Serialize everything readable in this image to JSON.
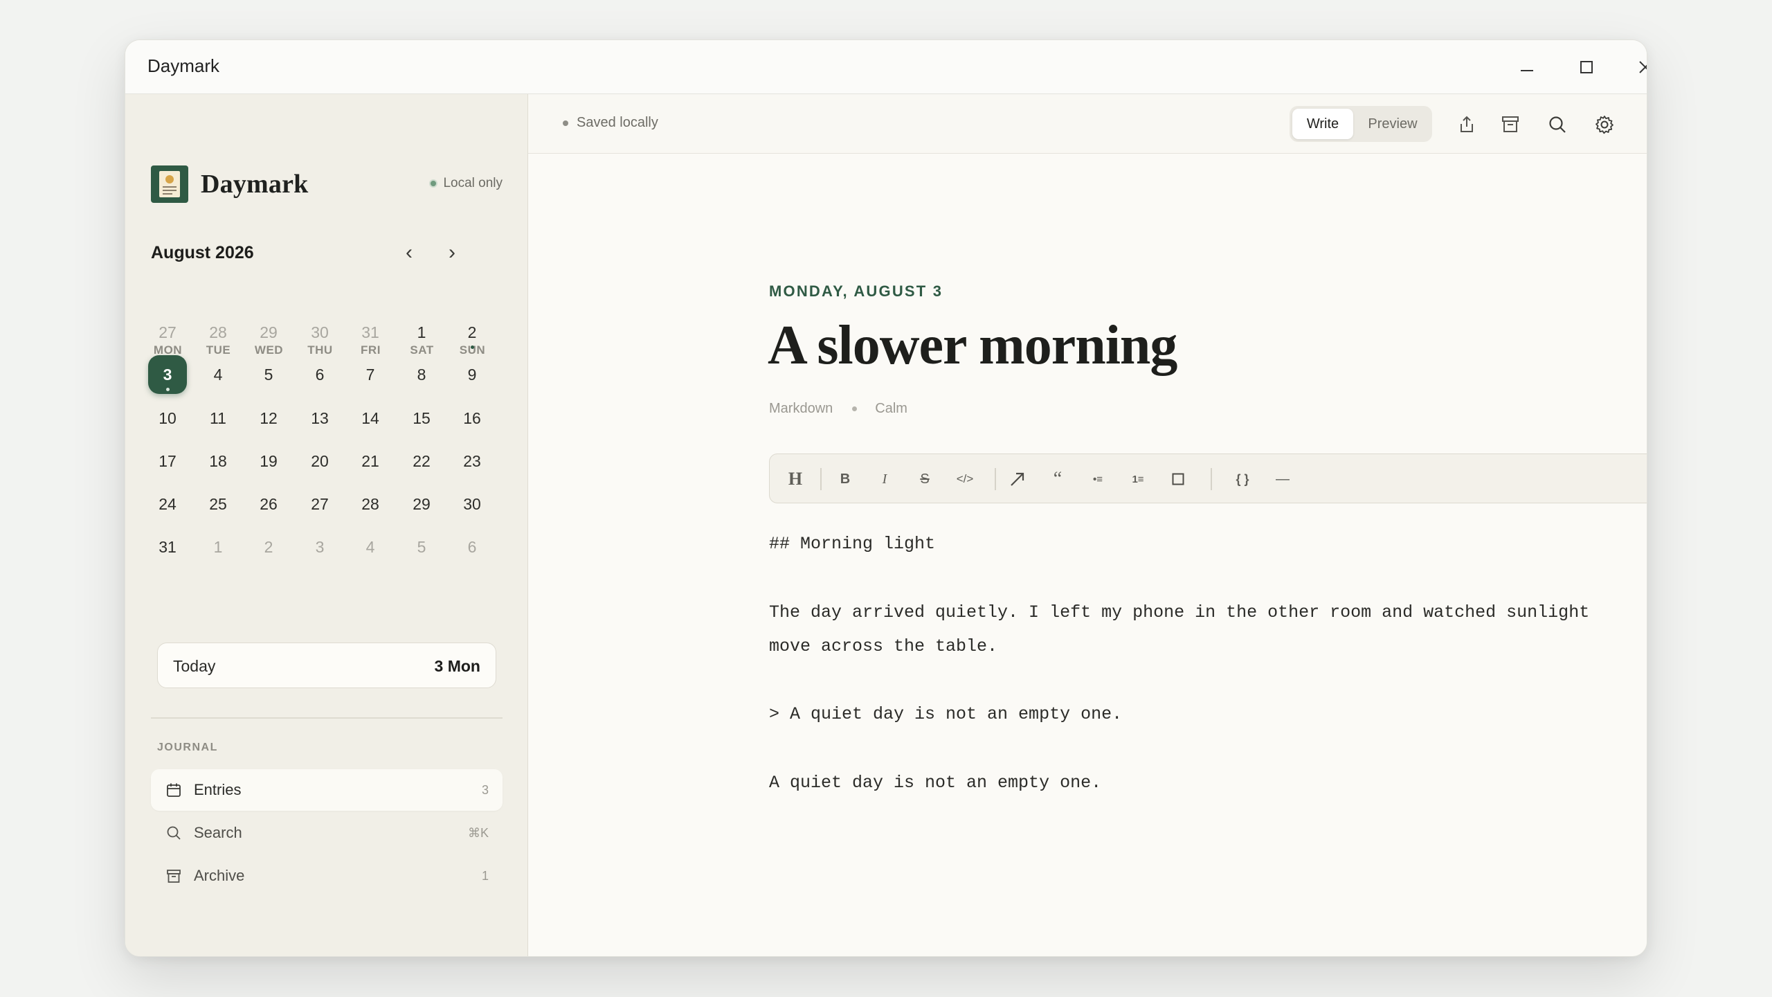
{
  "window": {
    "title": "Daymark"
  },
  "sidebar": {
    "brand": "Daymark",
    "storage_badge": "Local only",
    "calendar": {
      "month_label": "August 2026",
      "prev_glyph": "‹",
      "next_glyph": "›",
      "weekdays": [
        "MON",
        "TUE",
        "WED",
        "THU",
        "FRI",
        "SAT",
        "SUN"
      ],
      "weeks": [
        [
          "27",
          "28",
          "29",
          "30",
          "31",
          "1",
          "2"
        ],
        [
          "3",
          "4",
          "5",
          "6",
          "7",
          "8",
          "9"
        ],
        [
          "10",
          "11",
          "12",
          "13",
          "14",
          "15",
          "16"
        ],
        [
          "17",
          "18",
          "19",
          "20",
          "21",
          "22",
          "23"
        ],
        [
          "24",
          "25",
          "26",
          "27",
          "28",
          "29",
          "30"
        ],
        [
          "31",
          "1",
          "2",
          "3",
          "4",
          "5",
          "6"
        ]
      ],
      "selected_day": "3",
      "days_with_entries": [
        "2",
        "3"
      ]
    },
    "today": {
      "label": "Today",
      "value": "3 Mon"
    },
    "section_label": "JOURNAL",
    "nav": [
      {
        "label": "Entries",
        "count": "3",
        "icon": "calendar-icon"
      },
      {
        "label": "Search",
        "count": "⌘K",
        "icon": "search-icon"
      },
      {
        "label": "Archive",
        "count": "1",
        "icon": "archive-icon"
      }
    ]
  },
  "main": {
    "status": "Saved locally",
    "mode_tabs": {
      "write": "Write",
      "preview": "Preview",
      "active": "Write"
    },
    "entry": {
      "date_label": "MONDAY, AUGUST 3",
      "title": "A slower morning",
      "format": "Markdown",
      "mood": "Calm"
    },
    "formatting": {
      "heading": "H",
      "bold": "B",
      "italic": "I",
      "strike": "S",
      "code": "</>",
      "quote": "“",
      "bullet": "•≡",
      "numbered": "1≡",
      "code_block": "{ }",
      "rule": "—"
    },
    "editor_lines": {
      "l1": "## Morning light",
      "l2": "The day arrived quietly. I left my phone in the other room and watched sunlight",
      "l3": "move across the table.",
      "l4": "> A quiet day is not an empty one.",
      "l5": "A quiet day is not an empty one."
    }
  },
  "colors": {
    "accent": "#2f5a44",
    "sidebar_bg": "#f1efe7",
    "editor_bg": "#fbfaf6"
  }
}
